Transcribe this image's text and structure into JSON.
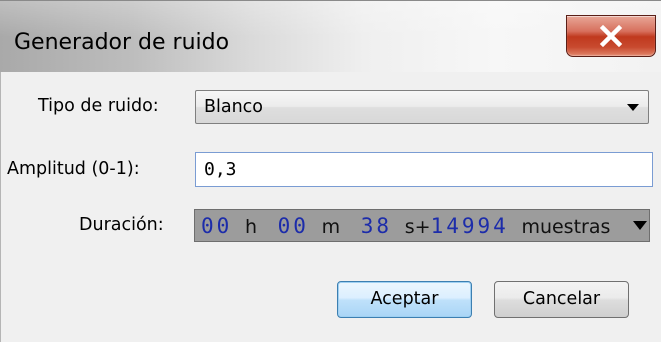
{
  "window": {
    "title": "Generador de ruido",
    "close_icon": "close-x-icon"
  },
  "form": {
    "noise_type": {
      "label": "Tipo de ruido:",
      "selected": "Blanco"
    },
    "amplitude": {
      "label": "Amplitud (0-1):",
      "value": "0,3"
    },
    "duration": {
      "label": "Duración:",
      "hours": "00",
      "hours_unit": "h",
      "minutes": "00",
      "minutes_unit": "m",
      "seconds": "38",
      "seconds_unit": "s+",
      "samples": "14994",
      "samples_unit": "muestras"
    }
  },
  "buttons": {
    "ok": "Aceptar",
    "cancel": "Cancelar"
  },
  "colors": {
    "digit": "#1c2caa",
    "duration_bg": "#9c9c9c",
    "close_button": "#c0391e"
  }
}
